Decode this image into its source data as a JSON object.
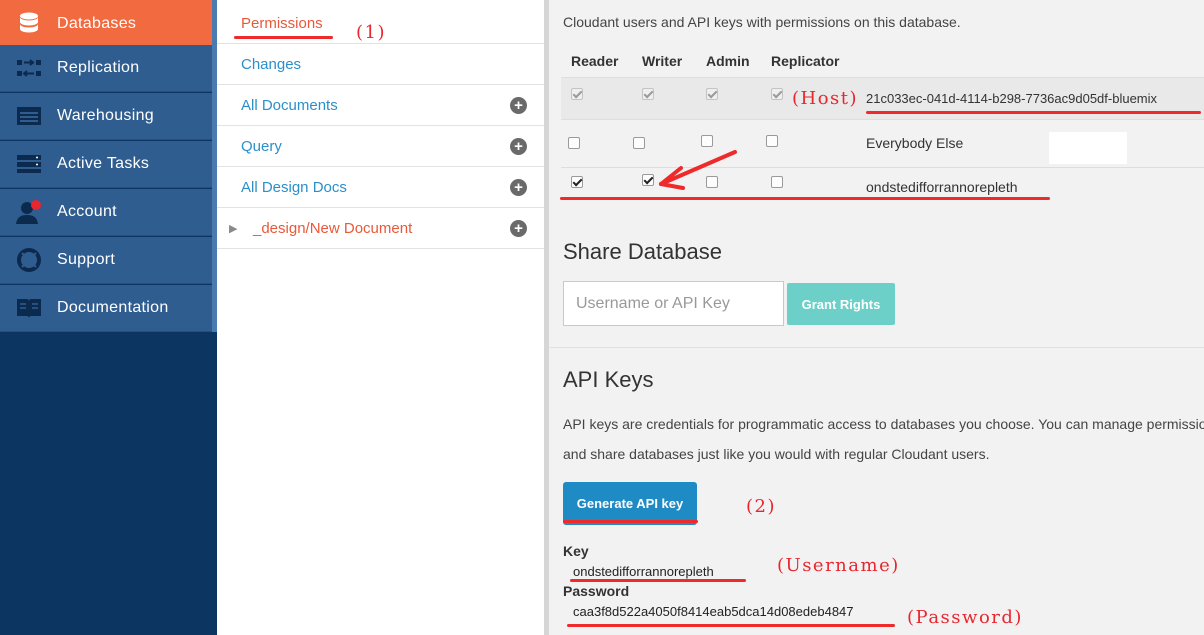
{
  "sidebar": {
    "items": [
      {
        "label": "Databases",
        "icon": "database-icon"
      },
      {
        "label": "Replication",
        "icon": "replication-icon"
      },
      {
        "label": "Warehousing",
        "icon": "warehouse-icon"
      },
      {
        "label": "Active Tasks",
        "icon": "tasks-icon"
      },
      {
        "label": "Account",
        "icon": "account-icon"
      },
      {
        "label": "Support",
        "icon": "lifebuoy-icon"
      },
      {
        "label": "Documentation",
        "icon": "book-icon"
      }
    ],
    "active_color": "#f26a3f"
  },
  "nav": {
    "items": [
      {
        "label": "Permissions"
      },
      {
        "label": "Changes"
      },
      {
        "label": "All Documents"
      },
      {
        "label": "Query"
      },
      {
        "label": "All Design Docs"
      },
      {
        "label": "_design/New Document"
      }
    ]
  },
  "permissions": {
    "intro": "Cloudant users and API keys with permissions on this database.",
    "headers": [
      "Reader",
      "Writer",
      "Admin",
      "Replicator"
    ],
    "rows": [
      {
        "name": "21c033ec-041d-4114-b298-7736ac9d05df-bluemix",
        "checks": [
          true,
          true,
          true,
          true
        ],
        "disabled": true
      },
      {
        "name": "Everybody Else",
        "checks": [
          false,
          false,
          false,
          false
        ],
        "disabled": false
      },
      {
        "name": "ondstedifforrannorepleth",
        "checks": [
          true,
          true,
          false,
          false
        ],
        "disabled": false
      }
    ]
  },
  "share": {
    "title": "Share Database",
    "placeholder": "Username or API Key",
    "button": "Grant Rights"
  },
  "apikeys": {
    "title": "API Keys",
    "line1": "API keys are credentials for programmatic access to databases you choose. You can manage permissions",
    "line2": "and share databases just like you would with regular Cloudant users.",
    "button": "Generate API key",
    "key_label": "Key",
    "key_value": "ondstedifforrannorepleth",
    "password_label": "Password",
    "password_value": "caa3f8d522a4050f8414eab5dca14d08edeb4847"
  },
  "annotations": {
    "one": "(1)",
    "host": "(Host)",
    "two": "(2)",
    "username": "(Username)",
    "password": "(Password)",
    "color": "#e8262e"
  }
}
